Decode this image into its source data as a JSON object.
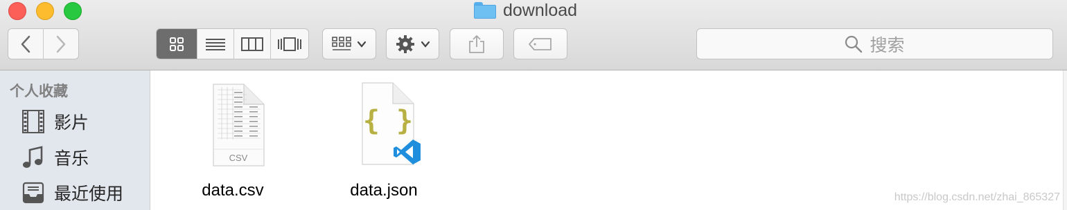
{
  "window": {
    "title": "download",
    "folder_icon": "folder-icon",
    "traffic_lights": [
      "#fc5f57",
      "#fdbc2e",
      "#28c840"
    ]
  },
  "toolbar": {
    "back_icon": "chevron-left-icon",
    "forward_icon": "chevron-right-icon",
    "view_modes": [
      {
        "name": "icon-view",
        "active": true
      },
      {
        "name": "list-view",
        "active": false
      },
      {
        "name": "column-view",
        "active": false
      },
      {
        "name": "cover-flow-view",
        "active": false
      }
    ],
    "arrange_icon": "arrange-grid-icon",
    "action_icon": "gear-icon",
    "share_icon": "share-icon",
    "tag_icon": "tag-icon"
  },
  "search": {
    "placeholder": "搜索",
    "icon": "search-icon"
  },
  "sidebar": {
    "heading": "个人收藏",
    "items": [
      {
        "label": "影片",
        "icon": "film-icon"
      },
      {
        "label": "音乐",
        "icon": "music-note-icon"
      },
      {
        "label": "最近使用",
        "icon": "recents-tray-icon"
      }
    ]
  },
  "files": [
    {
      "name": "data.csv",
      "type_label": "CSV",
      "icon": "csv-file-icon"
    },
    {
      "name": "data.json",
      "icon": "json-file-icon",
      "badge": "vscode-icon",
      "glyph": "{ }"
    }
  ],
  "watermark": "https://blog.csdn.net/zhai_865327",
  "colors": {
    "active_segment": "#6d6d6d",
    "sidebar_bg": "#e2e6ed",
    "json_brace": "#b8b043",
    "vscode_blue": "#1f8fdd"
  }
}
